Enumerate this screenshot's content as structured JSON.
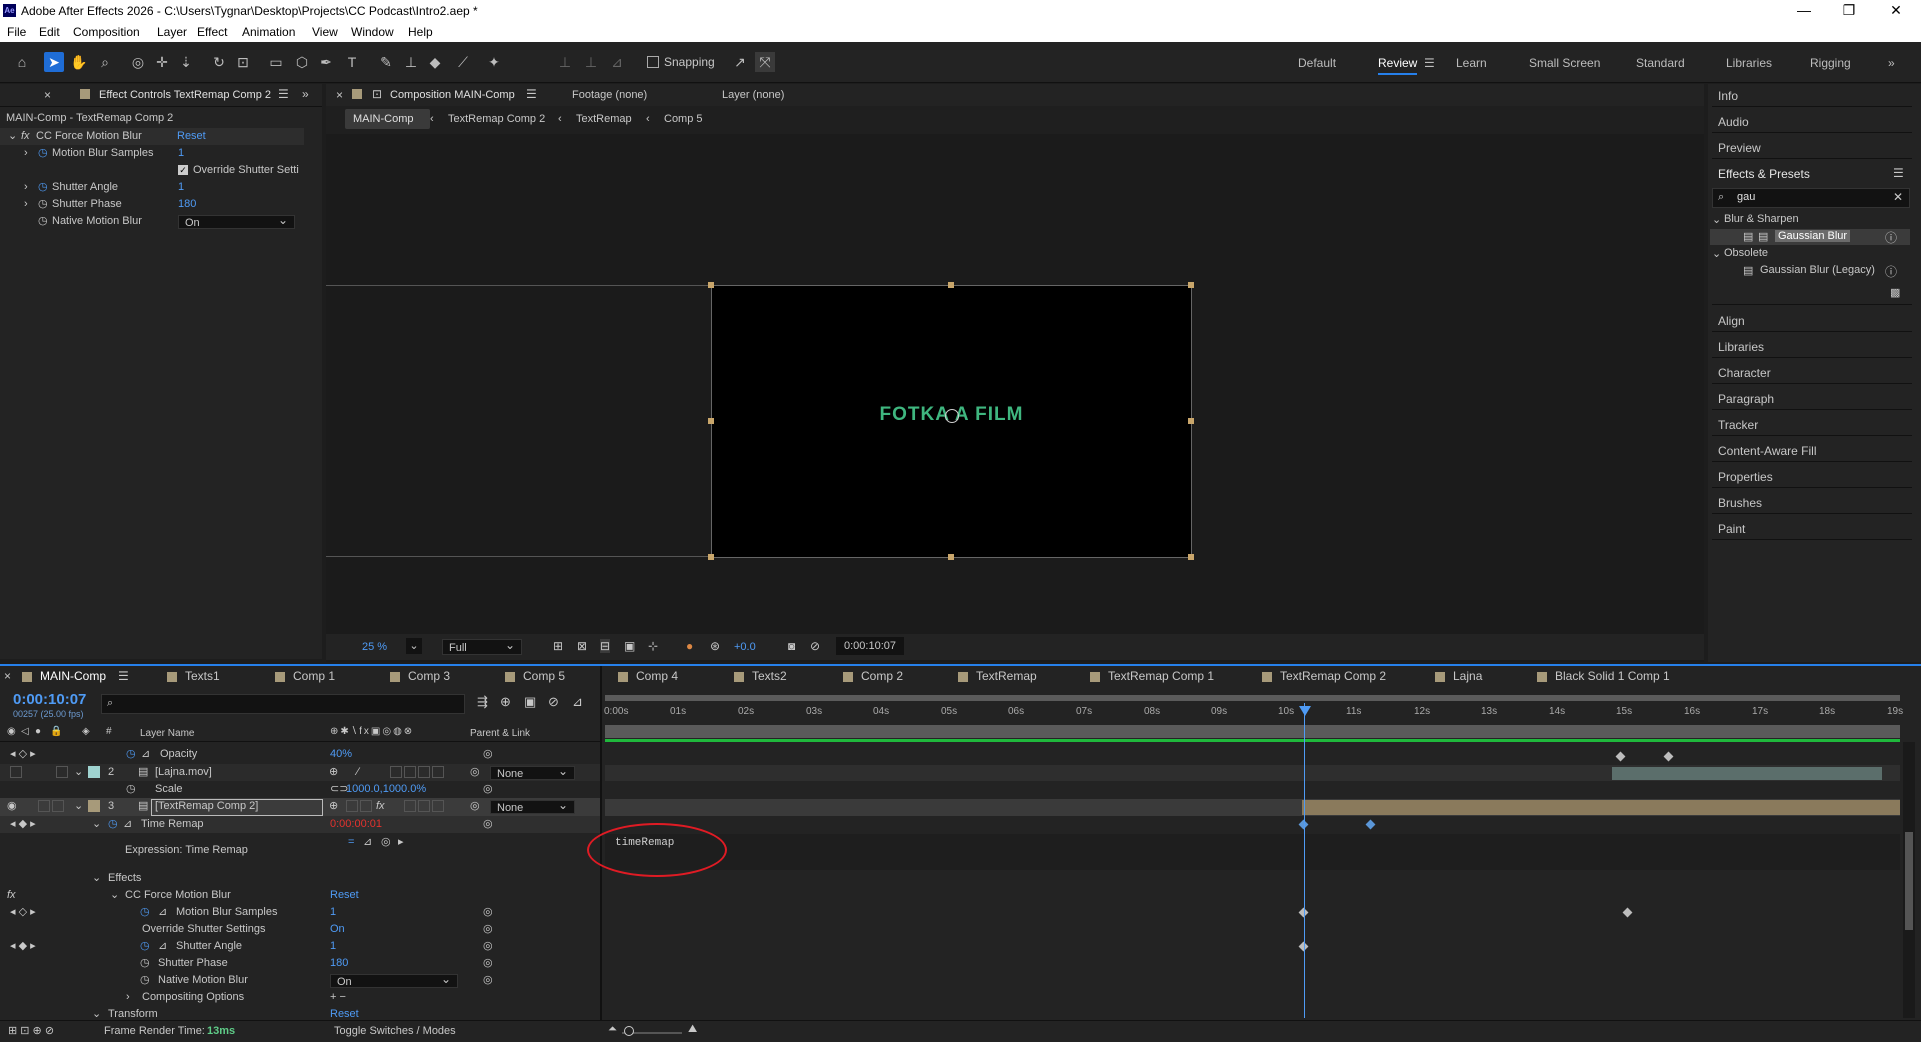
{
  "window": {
    "app_icon": "Ae",
    "title": "Adobe After Effects 2026 - C:\\Users\\Tygnar\\Desktop\\Projects\\CC Podcast\\Intro2.aep *",
    "controls": [
      "—",
      "❐",
      "✕"
    ]
  },
  "menu": [
    "File",
    "Edit",
    "Composition",
    "Layer",
    "Effect",
    "Animation",
    "View",
    "Window",
    "Help"
  ],
  "toolbar": {
    "snapping": "Snapping",
    "workspaces": [
      "Default",
      "Review",
      "Learn",
      "Small Screen",
      "Standard",
      "Libraries",
      "Rigging"
    ],
    "active_workspace": "Review",
    "more": "»"
  },
  "effect_controls": {
    "tab_label": "Effect Controls TextRemap Comp 2",
    "layer_path": "MAIN-Comp - TextRemap Comp 2",
    "effect_name": "CC Force Motion Blur",
    "reset": "Reset",
    "props": [
      {
        "label": "Motion Blur Samples",
        "value": "1"
      },
      {
        "label": "Override Shutter Setti",
        "value": ""
      },
      {
        "label": "Shutter Angle",
        "value": "1"
      },
      {
        "label": "Shutter Phase",
        "value": "180"
      },
      {
        "label": "Native Motion Blur",
        "value": "On"
      }
    ]
  },
  "composition": {
    "tab_label": "Composition MAIN-Comp",
    "footage_tab": "Footage (none)",
    "layer_tab": "Layer (none)",
    "breadcrumbs": [
      "MAIN-Comp",
      "TextRemap Comp 2",
      "TextRemap",
      "Comp 5"
    ],
    "canvas_text": "FOTKA A FILM",
    "zoom": "25 %",
    "resolution": "Full",
    "exposure": "+0.0",
    "timecode": "0:00:10:07"
  },
  "right_panel": {
    "info": "Info",
    "audio": "Audio",
    "preview": "Preview",
    "effects_presets": "Effects & Presets",
    "search_value": "gau",
    "groups": [
      {
        "name": "Blur & Sharpen",
        "items": [
          "Gaussian Blur"
        ]
      },
      {
        "name": "Obsolete",
        "items": [
          "Gaussian Blur (Legacy)"
        ]
      }
    ],
    "panels": [
      "Align",
      "Libraries",
      "Character",
      "Paragraph",
      "Tracker",
      "Content-Aware Fill",
      "Properties",
      "Brushes",
      "Paint"
    ]
  },
  "timeline": {
    "tabs": [
      "MAIN-Comp",
      "Texts1",
      "Comp 1",
      "Comp 3",
      "Comp 5",
      "Comp 4",
      "Texts2",
      "Comp 2",
      "TextRemap",
      "TextRemap Comp 1",
      "TextRemap Comp 2",
      "Lajna",
      "Black Solid 1 Comp 1"
    ],
    "tab_colors": [
      "#a79a7a",
      "#a79a7a",
      "#a79a7a",
      "#a79a7a",
      "#a79a7a",
      "#a79a7a",
      "#a79a7a",
      "#a79a7a",
      "#a79a7a",
      "#a79a7a",
      "#a79a7a",
      "#a79a7a",
      "#a79a7a"
    ],
    "current_time": "0:00:10:07",
    "frame_info": "00257 (25.00 fps)",
    "col_layer_name": "Layer Name",
    "col_parent": "Parent & Link",
    "ruler": [
      "0:00s",
      "01s",
      "02s",
      "03s",
      "04s",
      "05s",
      "06s",
      "07s",
      "08s",
      "09s",
      "10s",
      "11s",
      "12s",
      "13s",
      "14s",
      "15s",
      "16s",
      "17s",
      "18s",
      "19s"
    ],
    "rows": {
      "opacity": {
        "label": "Opacity",
        "value": "40%"
      },
      "layer2": {
        "num": "2",
        "name": "[Lajna.mov]",
        "parent": "None"
      },
      "scale": {
        "label": "Scale",
        "value": "1000.0,1000.0%"
      },
      "layer3": {
        "num": "3",
        "name": "[TextRemap Comp 2]",
        "parent": "None"
      },
      "time_remap": {
        "label": "Time Remap",
        "value": "0:00:00:01"
      },
      "expression": {
        "label": "Expression: Time Remap",
        "code": "timeRemap"
      },
      "effects": "Effects",
      "cc_force": {
        "label": "CC Force Motion Blur",
        "reset": "Reset"
      },
      "mbs": {
        "label": "Motion Blur Samples",
        "value": "1"
      },
      "override": {
        "label": "Override Shutter Settings",
        "value": "On"
      },
      "shutter_angle": {
        "label": "Shutter Angle",
        "value": "1"
      },
      "shutter_phase": {
        "label": "Shutter Phase",
        "value": "180"
      },
      "native_mb": {
        "label": "Native Motion Blur",
        "value": "On"
      },
      "compositing": "Compositing Options",
      "transform": {
        "label": "Transform",
        "reset": "Reset"
      }
    },
    "footer": {
      "render_label": "Frame Render Time:",
      "render_value": "13ms",
      "toggle": "Toggle Switches / Modes"
    }
  },
  "colors": {
    "accent": "#2680eb",
    "blue_value": "#4f9bf5",
    "canvas_text": "#3fb67f",
    "annotation": "#e01b24",
    "layer3_bar": "#8a7a5c",
    "layer2_bar": "#5b6e6b"
  }
}
